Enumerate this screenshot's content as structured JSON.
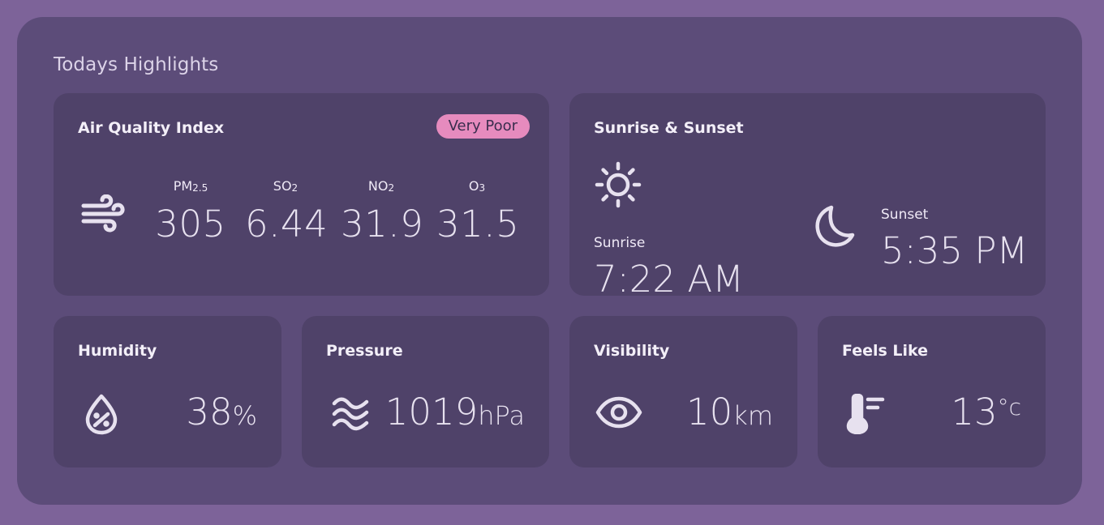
{
  "panel": {
    "title": "Todays Highlights"
  },
  "aqi": {
    "title": "Air Quality Index",
    "badge": "Very Poor",
    "badge_color": "#e68bbe",
    "icon": "wind-icon",
    "items": [
      {
        "name": "PM",
        "sub": "2.5",
        "value": "305"
      },
      {
        "name": "SO",
        "sub": "2",
        "value": "6.44"
      },
      {
        "name": "NO",
        "sub": "2",
        "value": "31.9"
      },
      {
        "name": "O",
        "sub": "3",
        "value": "31.5"
      }
    ]
  },
  "sun": {
    "title": "Sunrise & Sunset",
    "sunrise_label": "Sunrise",
    "sunrise_time": "7:22 AM",
    "sunset_label": "Sunset",
    "sunset_time": "5:35 PM"
  },
  "humidity": {
    "title": "Humidity",
    "value": "38",
    "unit": "%",
    "icon": "humidity-drop-icon"
  },
  "pressure": {
    "title": "Pressure",
    "value": "1019",
    "unit": "hPa",
    "icon": "waves-icon"
  },
  "visibility": {
    "title": "Visibility",
    "value": "10",
    "unit": "km",
    "icon": "eye-icon"
  },
  "feels_like": {
    "title": "Feels Like",
    "value": "13",
    "degree": "°",
    "unit": "c",
    "icon": "thermometer-icon"
  },
  "colors": {
    "background": "#7d6399",
    "panel": "#5c4c79",
    "card": "#4f4269",
    "text": "#ece6f3"
  }
}
